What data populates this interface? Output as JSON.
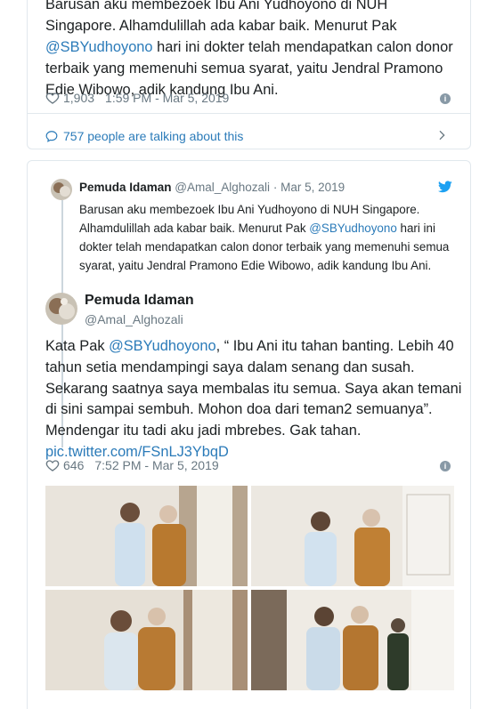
{
  "tweet1": {
    "text_lines": [
      "Barusan aku membezoek Ibu Ani Yudhoyono di NUH",
      "Singapore. Alhamdulillah ada kabar baik. Menurut Pak",
      "hari ini dokter telah mendapatkan calon donor",
      "terbaik yang memenuhi semua syarat, yaitu Jendral Pramono",
      "Edie Wibowo, adik kandung Ibu Ani."
    ],
    "mention": "@SBYudhoyono",
    "likes": "1,903",
    "time": "1:59 PM - Mar 5, 2019",
    "talking": "757 people are talking about this"
  },
  "tweet2": {
    "quoted": {
      "name": "Pemuda Idaman",
      "handle": "@Amal_Alghozali",
      "date": "· Mar 5, 2019",
      "text_before": "Barusan aku membezoek Ibu Ani Yudhoyono di NUH Singapore. Alhamdulillah ada kabar baik. Menurut Pak ",
      "mention": "@SBYudhoyono",
      "text_after": " hari ini dokter telah mendapatkan calon donor terbaik yang memenuhi semua syarat, yaitu Jendral Pramono Edie Wibowo, adik kandung Ibu Ani."
    },
    "name": "Pemuda Idaman",
    "handle": "@Amal_Alghozali",
    "text_before": "Kata Pak ",
    "mention": "@SBYudhoyono",
    "text_after": ", “ Ibu Ani itu tahan banting. Lebih 40 tahun  setia mendampingi saya dalam senang dan susah. Sekarang saatnya saya membalas itu semua. Saya akan temani di sini sampai sembuh. Mohon doa dari teman2 semuanya”. Mendengar itu tadi aku jadi mbrebes. Gak tahan.",
    "pic_link": "pic.twitter.com/FSnLJ3YbqD",
    "likes": "646",
    "time": "7:52 PM - Mar 5, 2019"
  },
  "colors": {
    "link": "#2b7bb9",
    "meta": "#697882",
    "border": "#e1e8ed",
    "bird": "#1da1f2"
  },
  "icons": [
    "heart-icon",
    "info-icon",
    "speech-bubble-icon",
    "chevron-right-icon",
    "twitter-bird-icon"
  ]
}
